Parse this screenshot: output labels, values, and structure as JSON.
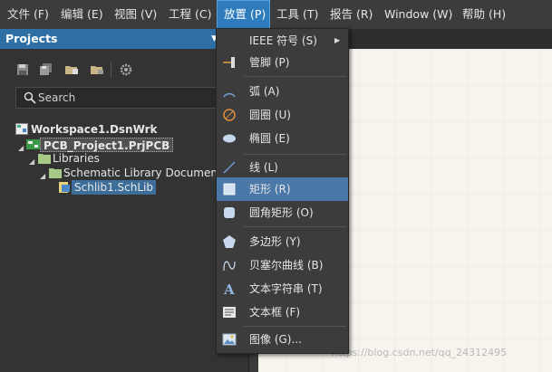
{
  "menubar": {
    "items": [
      {
        "label": "文件 (F)"
      },
      {
        "label": "编辑 (E)"
      },
      {
        "label": "视图 (V)"
      },
      {
        "label": "工程 (C)"
      },
      {
        "label": "放置 (P)"
      },
      {
        "label": "工具 (T)"
      },
      {
        "label": "报告 (R)"
      },
      {
        "label": "Window (W)"
      },
      {
        "label": "帮助 (H)"
      }
    ],
    "active_index": 4
  },
  "panel": {
    "title": "Projects",
    "search_placeholder": "Search"
  },
  "tree": {
    "workspace": "Workspace1.DsnWrk",
    "project": "PCB_Project1.PrjPCB",
    "libraries": "Libraries",
    "schematic_docs": "Schematic Library Documents",
    "schlib": "Schlib1.SchLib"
  },
  "place_menu": {
    "items": [
      {
        "label": "IEEE 符号 (S)",
        "icon": "none",
        "has_submenu": true
      },
      {
        "label": "管脚 (P)",
        "icon": "pin-icon"
      },
      {
        "label": "弧 (A)",
        "icon": "arc-icon"
      },
      {
        "label": "圆圈 (U)",
        "icon": "circle-icon"
      },
      {
        "label": "椭圆 (E)",
        "icon": "ellipse-icon"
      },
      {
        "label": "线 (L)",
        "icon": "line-icon"
      },
      {
        "label": "矩形 (R)",
        "icon": "rectangle-icon",
        "highlighted": true
      },
      {
        "label": "圆角矩形 (O)",
        "icon": "round-rectangle-icon"
      },
      {
        "label": "多边形 (Y)",
        "icon": "polygon-icon"
      },
      {
        "label": "贝塞尔曲线 (B)",
        "icon": "bezier-icon"
      },
      {
        "label": "文本字符串 (T)",
        "icon": "text-string-icon"
      },
      {
        "label": "文本框 (F)",
        "icon": "text-frame-icon"
      },
      {
        "label": "图像 (G)...",
        "icon": "image-icon"
      }
    ]
  },
  "watermark": "https://blog.csdn.net/qq_24312495",
  "colors": {
    "menubar_bg": "#3c3c3c",
    "active_menu": "#2e7cbd",
    "panel_header": "#2e6fa6",
    "highlight_item": "#4a78a8",
    "canvas_bg": "#f7f4ee"
  }
}
